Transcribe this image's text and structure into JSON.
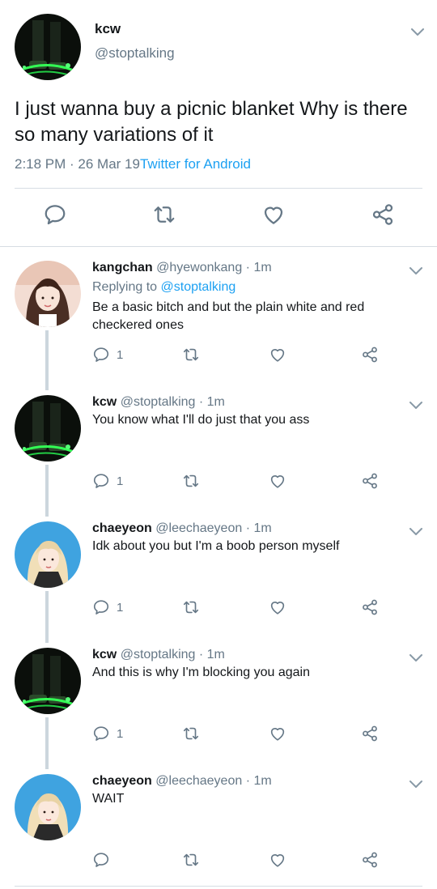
{
  "main_tweet": {
    "display_name": "kcw",
    "handle": "@stoptalking",
    "text": "I just wanna buy a picnic blanket Why is there so many variations of it",
    "time_date": "2:18 PM · 26 Mar 19",
    "source": "Twitter for Android"
  },
  "replies": [
    {
      "display_name": "kangchan",
      "handle_time": "@hyewonkang · 1m",
      "replying_prefix": "Replying to ",
      "replying_to": "@stoptalking",
      "text": "Be a basic bitch and but the plain white and red checkered ones",
      "reply_count": "1",
      "avatar": "light"
    },
    {
      "display_name": "kcw",
      "handle_time": "@stoptalking · 1m",
      "text": "You know what I'll do just that you ass",
      "reply_count": "1",
      "avatar": "dark"
    },
    {
      "display_name": "chaeyeon",
      "handle_time": "@leechaeyeon · 1m",
      "text": "Idk about you but I'm a boob person myself",
      "reply_count": "1",
      "avatar": "blue"
    },
    {
      "display_name": "kcw",
      "handle_time": "@stoptalking · 1m",
      "text": "And this is why I'm blocking you again",
      "reply_count": "1",
      "avatar": "dark"
    },
    {
      "display_name": "chaeyeon",
      "handle_time": "@leechaeyeon · 1m",
      "text": "WAIT",
      "reply_count": "",
      "avatar": "blue"
    }
  ],
  "icons": {
    "reply": "reply-icon",
    "retweet": "retweet-icon",
    "like": "heart-icon",
    "share": "share-icon",
    "more": "chevron-down-icon"
  },
  "colors": {
    "link": "#1da1f2",
    "secondary_text": "#657786",
    "icon": "#657786",
    "divider": "#d6dde3",
    "thread_line": "#ccd6dd"
  }
}
